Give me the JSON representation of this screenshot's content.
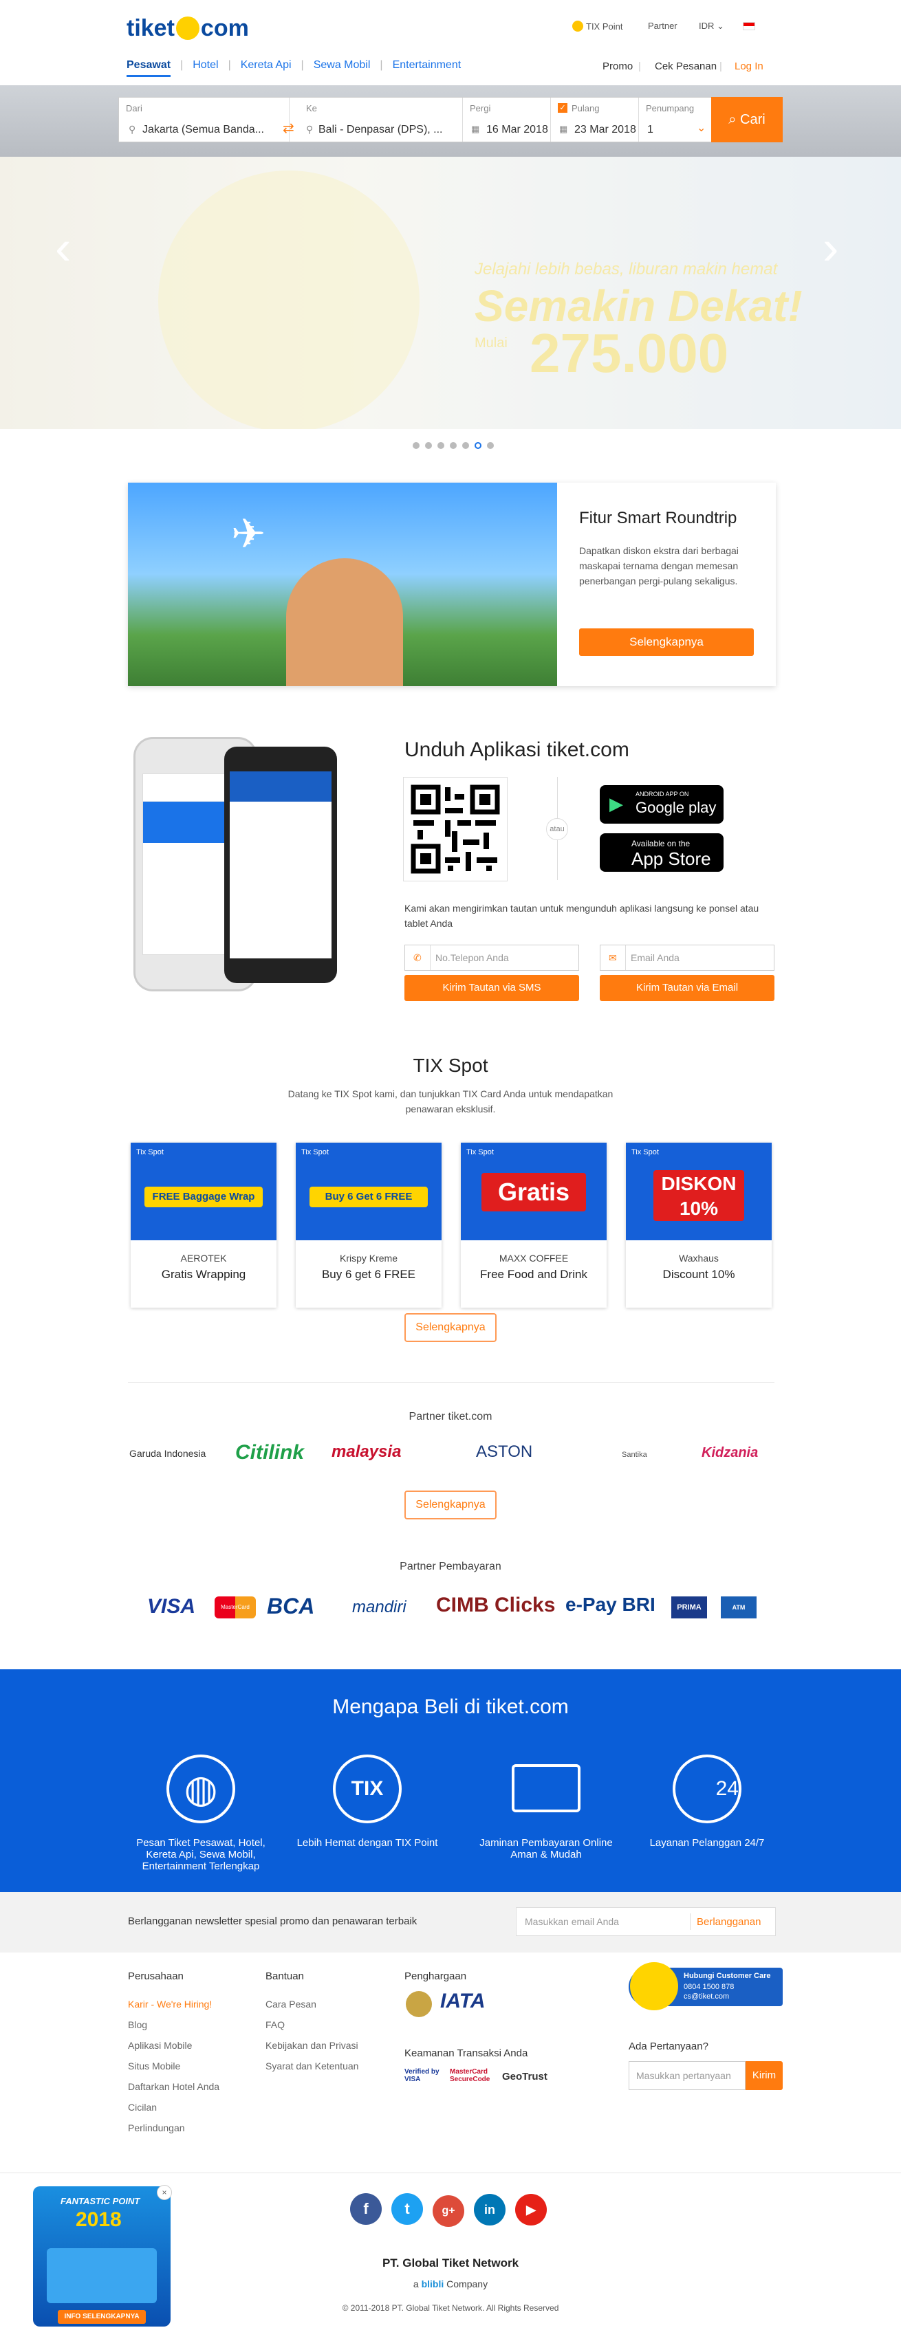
{
  "brand": {
    "logo_left": "tiket",
    "logo_right": "com"
  },
  "header": {
    "tix_point": "TIX Point",
    "partner": "Partner",
    "currency": "IDR"
  },
  "nav": {
    "tabs": [
      "Pesawat",
      "Hotel",
      "Kereta Api",
      "Sewa Mobil",
      "Entertainment"
    ],
    "promo": "Promo",
    "cek": "Cek Pesanan",
    "login": "Log In"
  },
  "search": {
    "dari_label": "Dari",
    "dari_value": "Jakarta (Semua Banda...",
    "ke_label": "Ke",
    "ke_value": "Bali - Denpasar (DPS), ...",
    "pergi_label": "Pergi",
    "pergi_value": "16 Mar 2018",
    "pulang_label": "Pulang",
    "pulang_value": "23 Mar 2018",
    "penumpang_label": "Penumpang",
    "penumpang_value": "1",
    "cari": "Cari"
  },
  "hero": {
    "line1": "Jelajahi lebih bebas, liburan makin hemat",
    "line2": "Semakin Dekat!",
    "line3": "Mulai",
    "price": "275.000"
  },
  "smart": {
    "title": "Fitur Smart Roundtrip",
    "desc": "Dapatkan diskon ekstra dari berbagai maskapai ternama dengan memesan penerbangan pergi-pulang sekaligus.",
    "button": "Selengkapnya"
  },
  "app": {
    "title": "Unduh Aplikasi tiket.com",
    "atau": "atau",
    "google": "Google play",
    "google_small": "ANDROID APP ON",
    "apple": "App Store",
    "apple_small": "Available on the",
    "desc": "Kami akan mengirimkan tautan untuk mengunduh aplikasi langsung ke ponsel atau tablet Anda",
    "phone_placeholder": "No.Telepon Anda",
    "email_placeholder": "Email Anda",
    "sms_btn": "Kirim Tautan via SMS",
    "email_btn": "Kirim Tautan via Email"
  },
  "tix": {
    "title": "TIX Spot",
    "desc": "Datang ke TIX Spot kami, dan tunjukkan TIX Card Anda untuk mendapatkan penawaran eksklusif.",
    "items": [
      {
        "brand": "AEROTEK",
        "offer": "Gratis Wrapping",
        "banner": "FREE Baggage Wrap"
      },
      {
        "brand": "Krispy Kreme",
        "offer": "Buy 6 get 6 FREE",
        "banner": "Buy 6 Get 6 FREE"
      },
      {
        "brand": "MAXX COFFEE",
        "offer": "Free Food and Drink",
        "banner": "Gratis"
      },
      {
        "brand": "Waxhaus",
        "offer": "Discount 10%",
        "banner": "DISKON 10%"
      }
    ],
    "spot_label": "Tix Spot",
    "button": "Selengkapnya"
  },
  "partners": {
    "title": "Partner tiket.com",
    "logos": [
      "Garuda Indonesia",
      "Citilink",
      "malaysia",
      "ASTON",
      "Santika",
      "Kidzania"
    ],
    "button": "Selengkapnya"
  },
  "payment": {
    "title": "Partner Pembayaran",
    "logos": [
      "VISA",
      "MasterCard",
      "BCA",
      "mandiri",
      "CIMB Clicks",
      "e-Pay BRI",
      "PRIMA",
      "ATM BERSAMA"
    ]
  },
  "why": {
    "title": "Mengapa Beli di tiket.com",
    "items": [
      "Pesan Tiket Pesawat, Hotel, Kereta Api, Sewa Mobil, Entertainment Terlengkap",
      "Lebih Hemat dengan TIX Point",
      "Jaminan Pembayaran Online Aman & Mudah",
      "Layanan Pelanggan 24/7"
    ],
    "tix_label": "TIX",
    "hours": "24"
  },
  "newsletter": {
    "text": "Berlangganan newsletter spesial promo dan penawaran terbaik",
    "placeholder": "Masukkan email Anda",
    "button": "Berlangganan"
  },
  "footer": {
    "perusahaan": {
      "title": "Perusahaan",
      "items": [
        "Karir - We're Hiring!",
        "Blog",
        "Aplikasi Mobile",
        "Situs Mobile",
        "Daftarkan Hotel Anda",
        "Cicilan",
        "Perlindungan"
      ]
    },
    "bantuan": {
      "title": "Bantuan",
      "items": [
        "Cara Pesan",
        "FAQ",
        "Kebijakan dan Privasi",
        "Syarat dan Ketentuan"
      ]
    },
    "penghargaan": "Penghargaan",
    "keamanan": "Keamanan Transaksi Anda",
    "security": [
      "Verified by VISA",
      "MasterCard SecureCode",
      "GeoTrust"
    ],
    "cs_title": "Hubungi Customer Care",
    "cs_phone": "0804 1500 878",
    "cs_email": "cs@tiket.com",
    "ada": "Ada Pertanyaan?",
    "q_placeholder": "Masukkan pertanyaan",
    "q_btn": "Kirim"
  },
  "bottom": {
    "company": "PT. Global Tiket Network",
    "a": "a",
    "blibli": "blibli",
    "company2": "Company",
    "copy": "© 2011-2018 PT. Global Tiket Network. All Rights Reserved"
  },
  "promo_popup": {
    "title": "FANTASTIC POINT",
    "year": "2018",
    "cta": "INFO SELENGKAPNYA"
  },
  "colors": {
    "orange": "#ff7b0f",
    "blue": "#0a5ed8",
    "navy": "#0a4a9f"
  }
}
